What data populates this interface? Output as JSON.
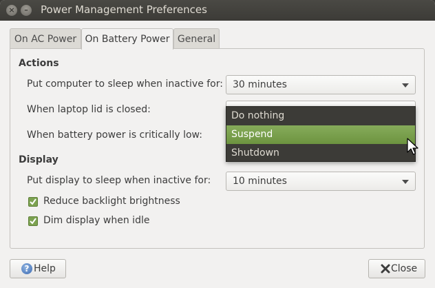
{
  "window": {
    "title": "Power Management Preferences"
  },
  "tabs": [
    {
      "label": "On AC Power",
      "active": false
    },
    {
      "label": "On Battery Power",
      "active": true
    },
    {
      "label": "General",
      "active": false
    }
  ],
  "actions": {
    "heading": "Actions",
    "sleep_label": "Put computer to sleep when inactive for:",
    "sleep_value": "30 minutes",
    "lid_label": "When laptop lid is closed:",
    "critical_label": "When battery power is critically low:"
  },
  "lid_menu": {
    "items": [
      {
        "label": "Do nothing",
        "selected": false
      },
      {
        "label": "Suspend",
        "selected": true
      },
      {
        "label": "Shutdown",
        "selected": false
      }
    ]
  },
  "display": {
    "heading": "Display",
    "sleep_label": "Put display to sleep when inactive for:",
    "sleep_value": "10 minutes",
    "reduce_backlight_label": "Reduce backlight brightness",
    "reduce_backlight_checked": true,
    "dim_label": "Dim display when idle",
    "dim_checked": true
  },
  "buttons": {
    "help_label": "Help",
    "close_label": "Close"
  },
  "colors": {
    "accent": "#7ca250",
    "menu_bg": "#3c3b37",
    "titlebar": "#3c3b37"
  },
  "icons": {
    "window_close": "close-icon",
    "window_minimize": "minimize-icon",
    "help": "help-icon",
    "close_button": "close-x-icon",
    "pointer": "mouse-pointer-icon"
  }
}
